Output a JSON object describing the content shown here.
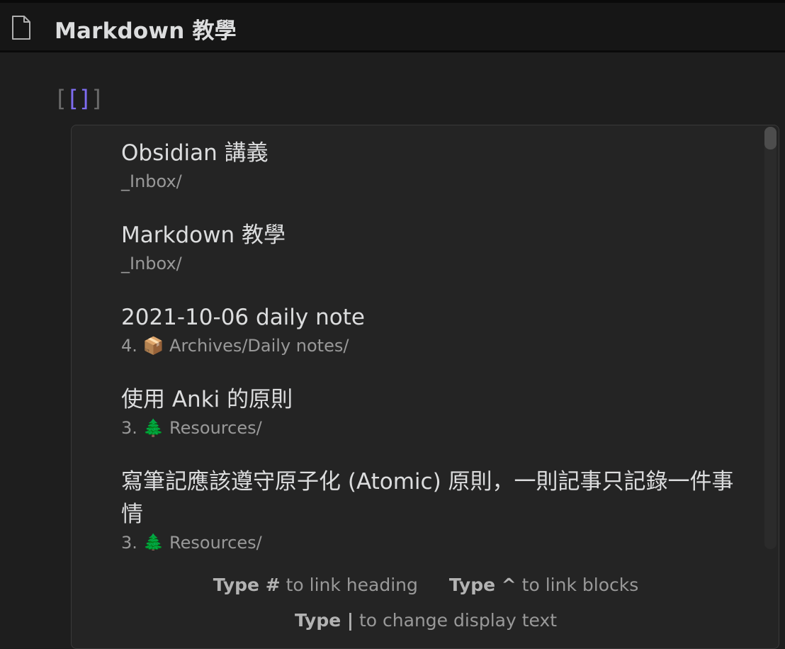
{
  "tab": {
    "title": "Markdown 教學",
    "icon": "file-icon"
  },
  "editor": {
    "link_open": "[",
    "link_inner": "[]",
    "link_close": "]"
  },
  "suggestions": [
    {
      "title": "Obsidian 講義",
      "path": "_Inbox/"
    },
    {
      "title": "Markdown 教學",
      "path": "_Inbox/"
    },
    {
      "title": "2021-10-06 daily note",
      "path": "4. 📦 Archives/Daily notes/"
    },
    {
      "title": "使用 Anki 的原則",
      "path": "3. 🌲 Resources/"
    },
    {
      "title": "寫筆記應該遵守原子化 (Atomic) 原則，一則記事只記錄一件事情",
      "path": "3. 🌲 Resources/"
    }
  ],
  "instructions": [
    {
      "command": "Type #",
      "purpose": "to link heading"
    },
    {
      "command": "Type ^",
      "purpose": "to link blocks"
    },
    {
      "command": "Type |",
      "purpose": "to change display text"
    }
  ],
  "colors": {
    "background": "#1e1e1e",
    "accent": "#7f6df2",
    "text": "#dcddde",
    "muted": "#999999"
  }
}
